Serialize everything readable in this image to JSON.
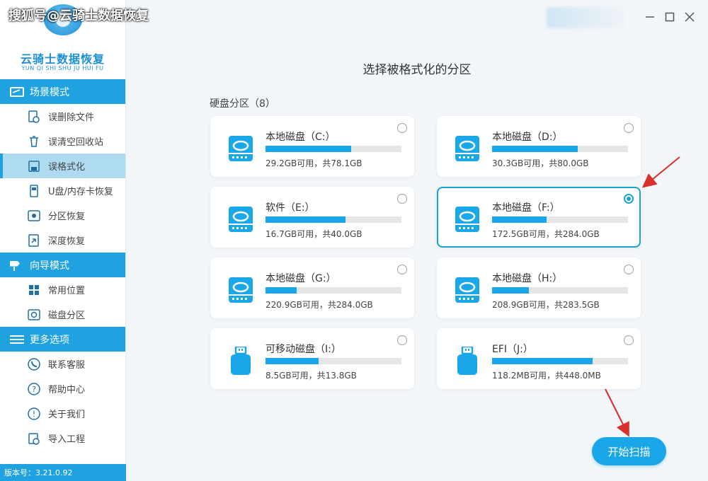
{
  "watermark": "搜狐号@云骑士数据恢复",
  "logo": {
    "title": "云骑士数据恢复",
    "pinyin": "YUN QI SHI SHU JU HUI FU"
  },
  "sidebar": {
    "scene_header": "场景模式",
    "scene_items": [
      {
        "label": "误删除文件",
        "icon": "file-delete-icon"
      },
      {
        "label": "误清空回收站",
        "icon": "recycle-bin-icon"
      },
      {
        "label": "误格式化",
        "icon": "disk-format-icon",
        "active": true
      },
      {
        "label": "U盘/内存卡恢复",
        "icon": "usb-card-icon"
      },
      {
        "label": "分区恢复",
        "icon": "partition-icon"
      },
      {
        "label": "深度恢复",
        "icon": "deep-recovery-icon"
      }
    ],
    "guide_header": "向导模式",
    "guide_items": [
      {
        "label": "常用位置",
        "icon": "windows-icon"
      },
      {
        "label": "磁盘分区",
        "icon": "disk-partition-icon"
      }
    ],
    "more_header": "更多选项",
    "more_items": [
      {
        "label": "联系客服",
        "icon": "phone-icon"
      },
      {
        "label": "帮助中心",
        "icon": "help-icon"
      },
      {
        "label": "关于我们",
        "icon": "info-icon"
      },
      {
        "label": "导入工程",
        "icon": "import-icon"
      }
    ],
    "version": "版本号：3.21.0.92"
  },
  "main": {
    "title": "选择被格式化的分区",
    "section_label": "硬盘分区（8）",
    "partitions": [
      {
        "name": "本地磁盘（C:）",
        "size": "29.2GB可用，共78.1GB",
        "used_fraction": 0.63,
        "type": "hdd",
        "selected": false
      },
      {
        "name": "本地磁盘（D:）",
        "size": "30.3GB可用，共80.0GB",
        "used_fraction": 0.63,
        "type": "hdd",
        "selected": false
      },
      {
        "name": "软件（E:）",
        "size": "16.7GB可用，共40.0GB",
        "used_fraction": 0.59,
        "type": "hdd",
        "selected": false
      },
      {
        "name": "本地磁盘（F:）",
        "size": "172.5GB可用，共284.0GB",
        "used_fraction": 0.4,
        "type": "hdd",
        "selected": true
      },
      {
        "name": "本地磁盘（G:）",
        "size": "220.9GB可用，共284.0GB",
        "used_fraction": 0.23,
        "type": "hdd",
        "selected": false
      },
      {
        "name": "本地磁盘（H:）",
        "size": "208.9GB可用，共283.5GB",
        "used_fraction": 0.27,
        "type": "hdd",
        "selected": false
      },
      {
        "name": "可移动磁盘（I:）",
        "size": "8.5GB可用，共13.8GB",
        "used_fraction": 0.39,
        "type": "usb",
        "selected": false
      },
      {
        "name": "EFI（J:）",
        "size": "118.2MB可用，共448.0MB",
        "used_fraction": 0.74,
        "type": "usb",
        "selected": false
      }
    ],
    "start_button": "开始扫描"
  },
  "colors": {
    "accent": "#1aa7ea",
    "sidebar_header": "#21a2e0",
    "active_item": "#aedbf0",
    "arrow": "#d9302c"
  }
}
